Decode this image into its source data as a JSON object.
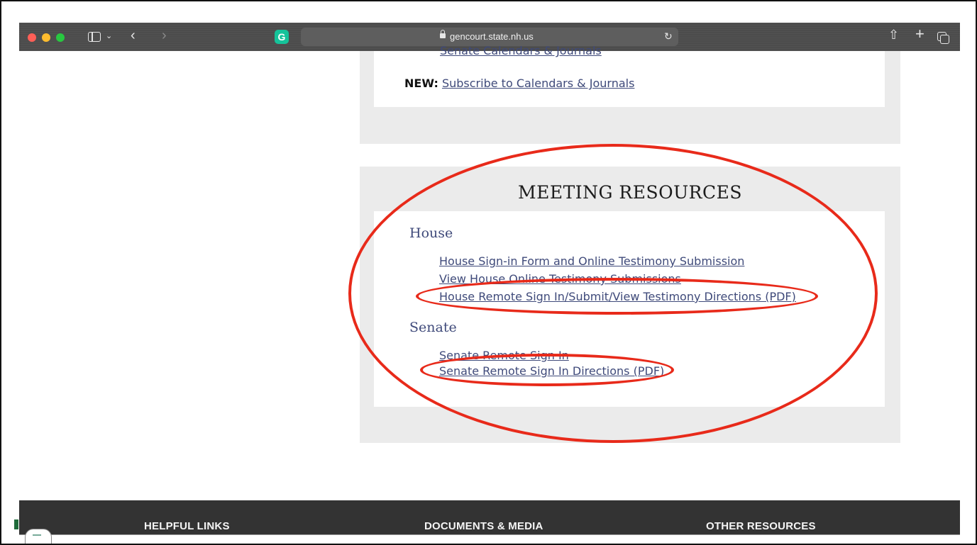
{
  "browser": {
    "url": "gencourt.state.nh.us",
    "extension_letter": "G"
  },
  "top_panel": {
    "clipped_link": "Senate Calendars & Journals",
    "new_label": "NEW:",
    "subscribe_link": "Subscribe to Calendars & Journals"
  },
  "meeting": {
    "title": "MEETING RESOURCES",
    "house": {
      "heading": "House",
      "links": [
        "House Sign-in Form and Online Testimony Submission",
        "View House Online Testimony Submissions",
        "House Remote Sign In/Submit/View Testimony Directions (PDF)"
      ]
    },
    "senate": {
      "heading": "Senate",
      "links": [
        "Senate Remote Sign In",
        "Senate Remote Sign In Directions (PDF)"
      ]
    }
  },
  "footer": {
    "col1": "HELPFUL LINKS",
    "col2": "DOCUMENTS & MEDIA",
    "col3": "OTHER RESOURCES"
  },
  "colors": {
    "link": "#3f4a7a",
    "annotation": "#e82a1a",
    "footer_bg": "#333333",
    "panel_bg": "#ebebeb"
  }
}
